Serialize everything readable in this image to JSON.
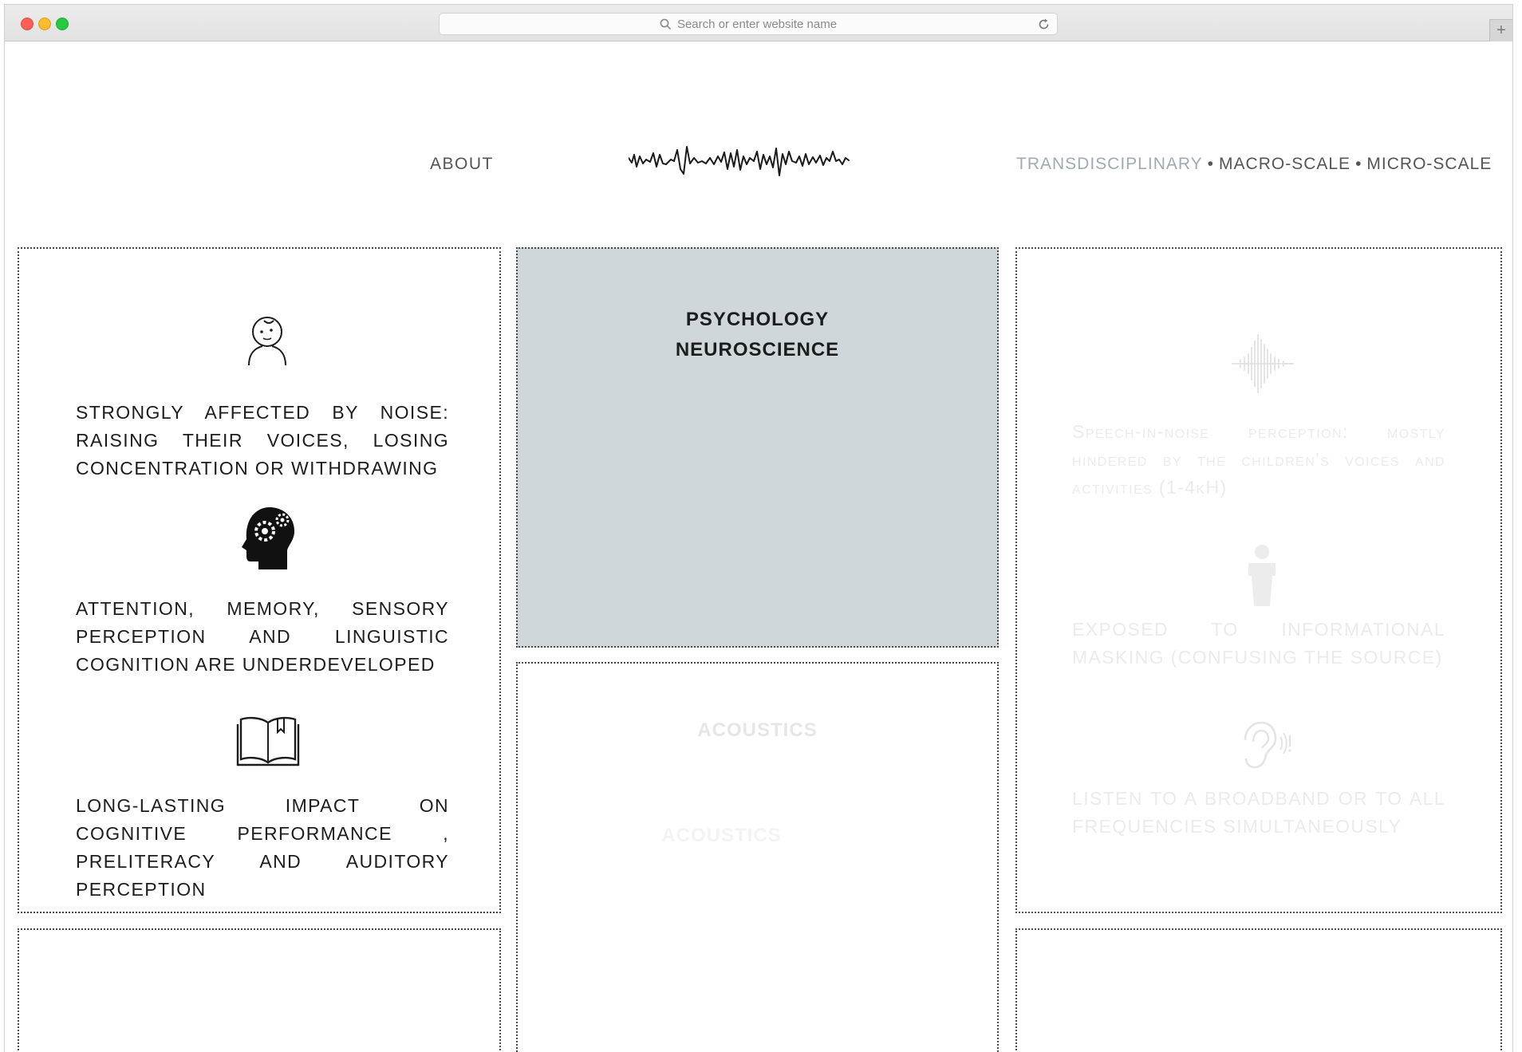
{
  "browser": {
    "address_placeholder": "Search or enter website name",
    "new_tab": "+"
  },
  "nav": {
    "about": "ABOUT",
    "items": [
      "TRANSDISCIPLINARY",
      "MACRO-SCALE",
      "MICRO-SCALE"
    ],
    "separator": "•",
    "active_color": "#9eabb2"
  },
  "col_left": {
    "items": [
      {
        "icon": "child-face-icon",
        "text": "STRONGLY AFFECTED BY NOISE: RAISING THEIR VOICES, LOSING CONCENTRATION OR WITHDRAWING"
      },
      {
        "icon": "brain-gears-icon",
        "text": "ATTENTION, MEMORY, SENSORY PERCEPTION AND LINGUISTIC COGNITION ARE UNDERDEVELOPED"
      },
      {
        "icon": "open-book-icon",
        "text": "LONG-LASTING IMPACT ON COGNITIVE PERFORMANCE , PRELITERACY AND AUDITORY PERCEPTION"
      }
    ]
  },
  "col_center": {
    "active_panel": {
      "line1": "PSYCHOLOGY",
      "line2": "NEUROSCIENCE",
      "bg_color": "#d0d7da"
    },
    "inactive_panel": {
      "title": "ACOUSTICS",
      "ghost_title": "ACOUSTICS"
    }
  },
  "col_right": {
    "items": [
      {
        "icon": "sound-wave-icon",
        "text": "Speech-in-noise perception: mostly hindered by the children's voices and activities (1-4kH)"
      },
      {
        "icon": "person-icon",
        "text": "EXPOSED TO INFORMATIONAL MASKING (CONFUSING THE SOURCE)"
      },
      {
        "icon": "ear-icon",
        "text": "LISTEN TO A BROADBAND OR TO ALL FREQUENCIES SIMULTANEOUSLY"
      }
    ]
  }
}
